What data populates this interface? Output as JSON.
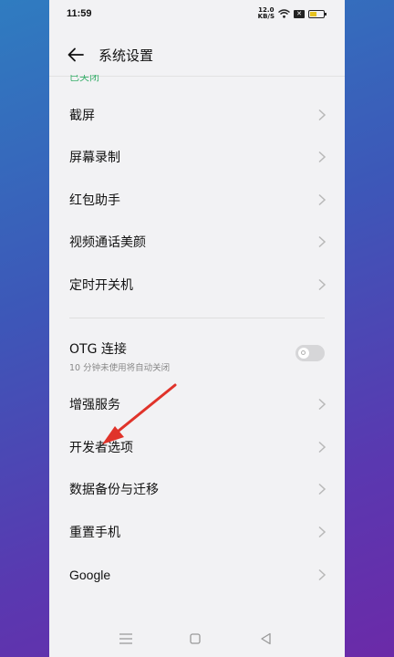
{
  "status": {
    "time": "11:59",
    "net_top": "12.0",
    "net_bottom": "KB/S",
    "battery_level": 0.55
  },
  "header": {
    "title": "系统设置",
    "back_icon": "arrow-left-icon"
  },
  "partial_text": "已关闭",
  "items_group1": [
    {
      "label": "截屏"
    },
    {
      "label": "屏幕录制"
    },
    {
      "label": "红包助手"
    },
    {
      "label": "视频通话美颜"
    },
    {
      "label": "定时开关机"
    }
  ],
  "otg": {
    "label": "OTG 连接",
    "sub": "10 分钟未使用将自动关闭",
    "enabled": false
  },
  "items_group2": [
    {
      "label": "增强服务"
    },
    {
      "label": "开发者选项"
    },
    {
      "label": "数据备份与迁移"
    },
    {
      "label": "重置手机"
    },
    {
      "label": "Google"
    }
  ],
  "annotation": {
    "color": "#e0332a",
    "points_to": "开发者选项"
  },
  "colors": {
    "accent_green": "#3bb06d"
  }
}
